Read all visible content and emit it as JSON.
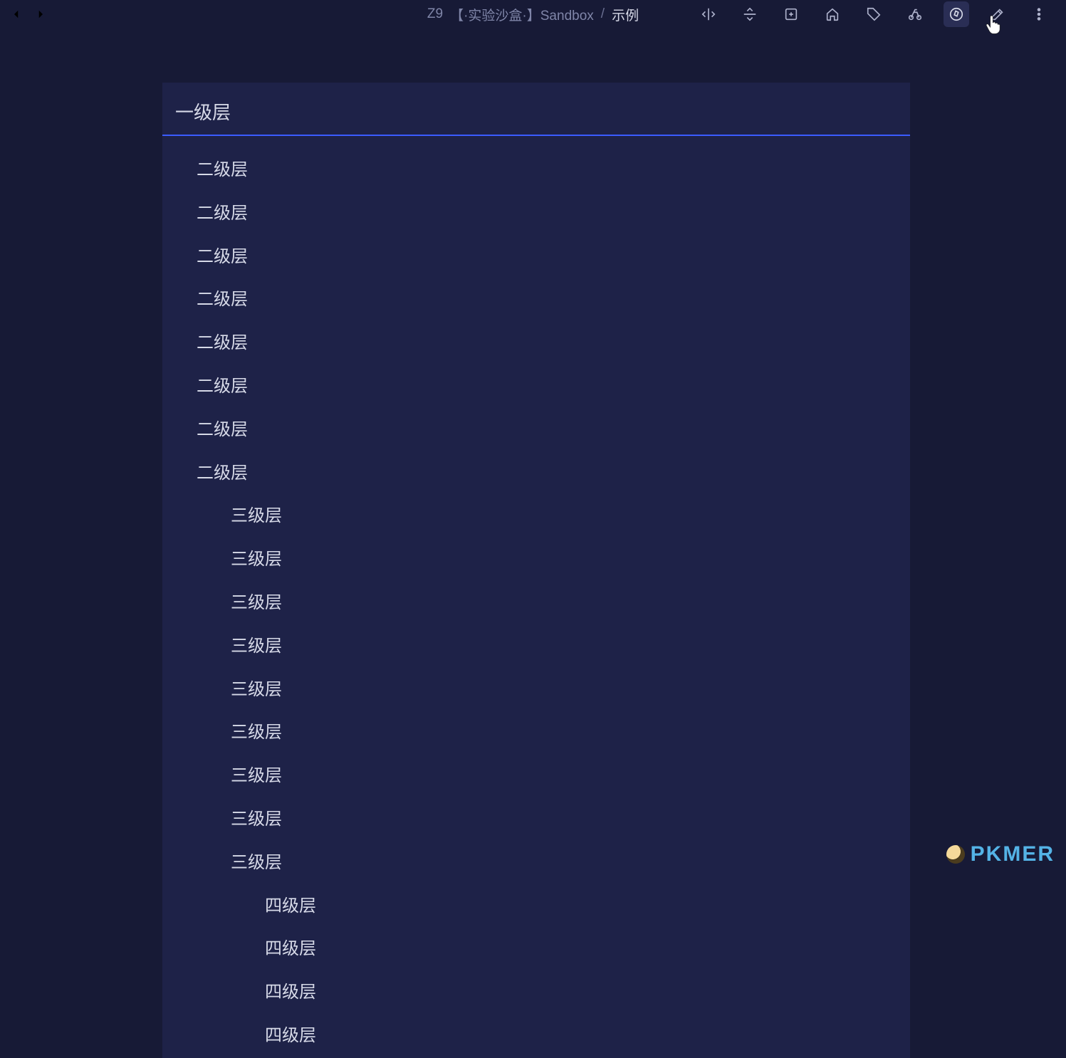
{
  "breadcrumb": {
    "part1": "Z9",
    "part2": "【·实验沙盒·】Sandbox",
    "sep": "/",
    "active": "示例"
  },
  "toolbar_icons": [
    "split-vertical-icon",
    "split-horizontal-icon",
    "add-note-icon",
    "home-icon",
    "tag-icon",
    "bike-icon",
    "compass-icon",
    "edit-icon",
    "more-icon"
  ],
  "headings": {
    "h1": "一级层",
    "h2_items": [
      "二级层",
      "二级层",
      "二级层",
      "二级层",
      "二级层",
      "二级层",
      "二级层",
      "二级层"
    ],
    "h3_items": [
      "三级层",
      "三级层",
      "三级层",
      "三级层",
      "三级层",
      "三级层",
      "三级层",
      "三级层",
      "三级层"
    ],
    "h4_items": [
      "四级层",
      "四级层",
      "四级层",
      "四级层"
    ]
  },
  "watermark": "PKMER"
}
